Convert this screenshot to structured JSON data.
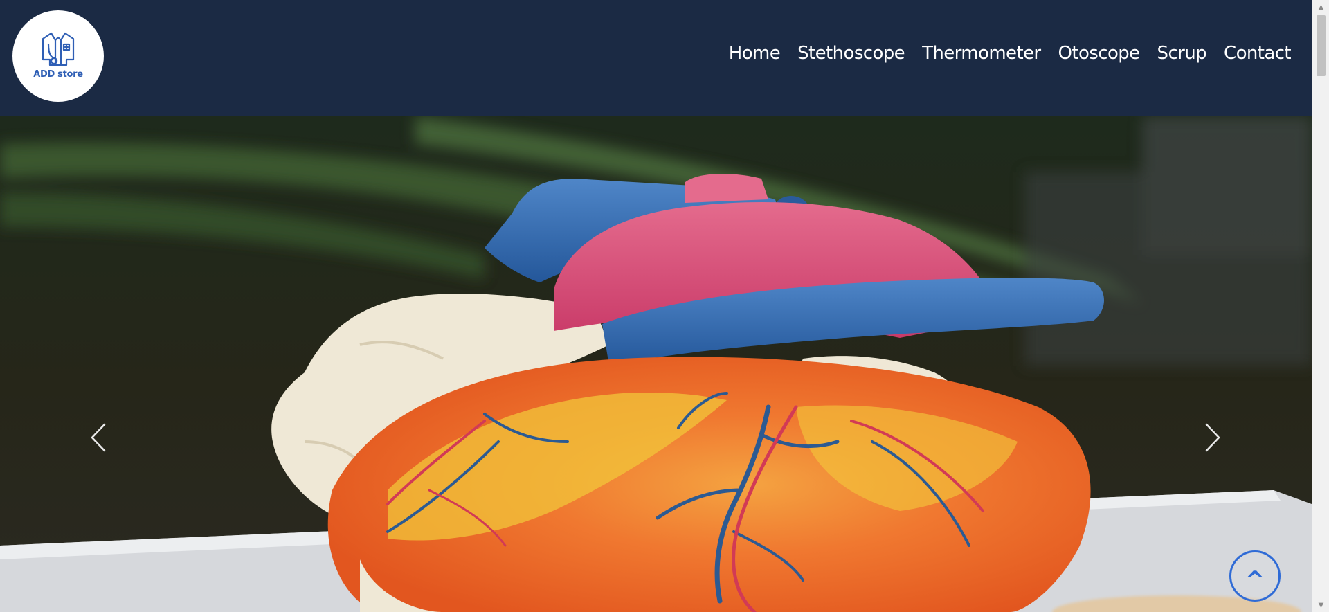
{
  "brand": {
    "logo_text": "ADD store",
    "logo_color": "#2f5fb5",
    "icon": "lab-coat-stethoscope-logo-icon"
  },
  "nav": {
    "items": [
      {
        "label": "Home"
      },
      {
        "label": "Stethoscope"
      },
      {
        "label": "Thermometer"
      },
      {
        "label": "Otoscope"
      },
      {
        "label": "Scrup"
      },
      {
        "label": "Contact"
      }
    ]
  },
  "carousel": {
    "image_subject": "anatomical-heart-model",
    "prev_icon": "chevron-left-icon",
    "next_icon": "chevron-right-icon"
  },
  "scroll_top": {
    "label": "^",
    "color": "#2f6bd6"
  },
  "colors": {
    "header_bg": "#1b2a44",
    "nav_text": "#ffffff"
  }
}
